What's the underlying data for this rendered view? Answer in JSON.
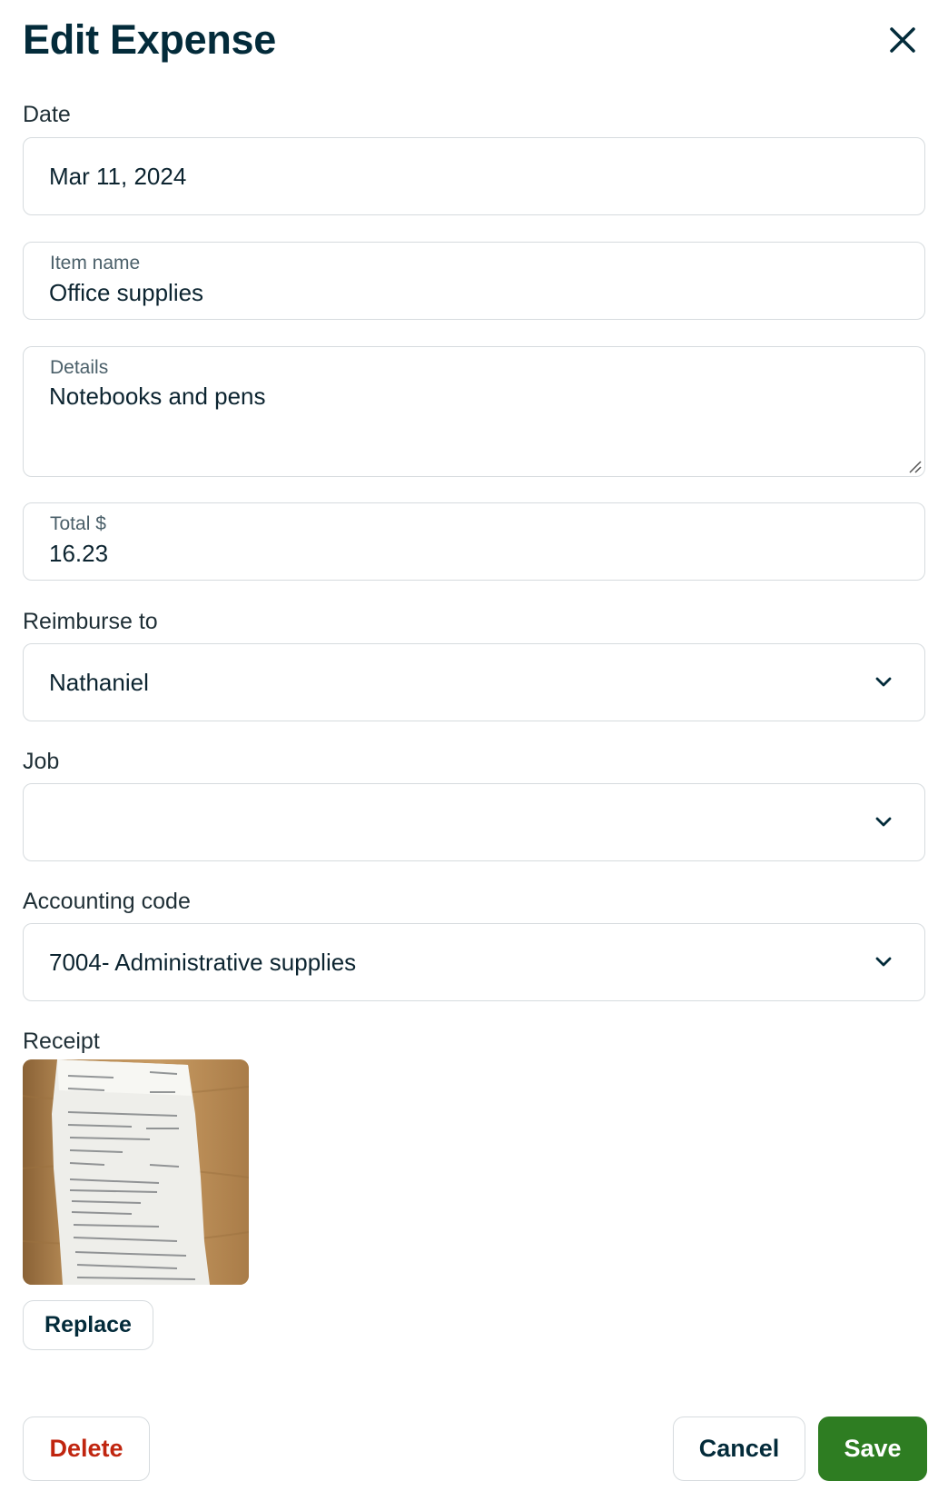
{
  "header": {
    "title": "Edit Expense"
  },
  "date": {
    "label": "Date",
    "value": "Mar 11, 2024"
  },
  "item_name": {
    "label": "Item name",
    "value": "Office supplies"
  },
  "details": {
    "label": "Details",
    "value": "Notebooks and pens"
  },
  "total": {
    "label": "Total $",
    "value": "16.23"
  },
  "reimburse_to": {
    "label": "Reimburse to",
    "value": "Nathaniel"
  },
  "job": {
    "label": "Job",
    "value": ""
  },
  "accounting_code": {
    "label": "Accounting code",
    "value": "7004- Administrative supplies"
  },
  "receipt": {
    "label": "Receipt",
    "replace_label": "Replace"
  },
  "footer": {
    "delete_label": "Delete",
    "cancel_label": "Cancel",
    "save_label": "Save"
  },
  "colors": {
    "primary_text": "#032b3a",
    "save_bg": "#2e7d22",
    "delete_text": "#c0250f",
    "border": "#d6dbde"
  }
}
